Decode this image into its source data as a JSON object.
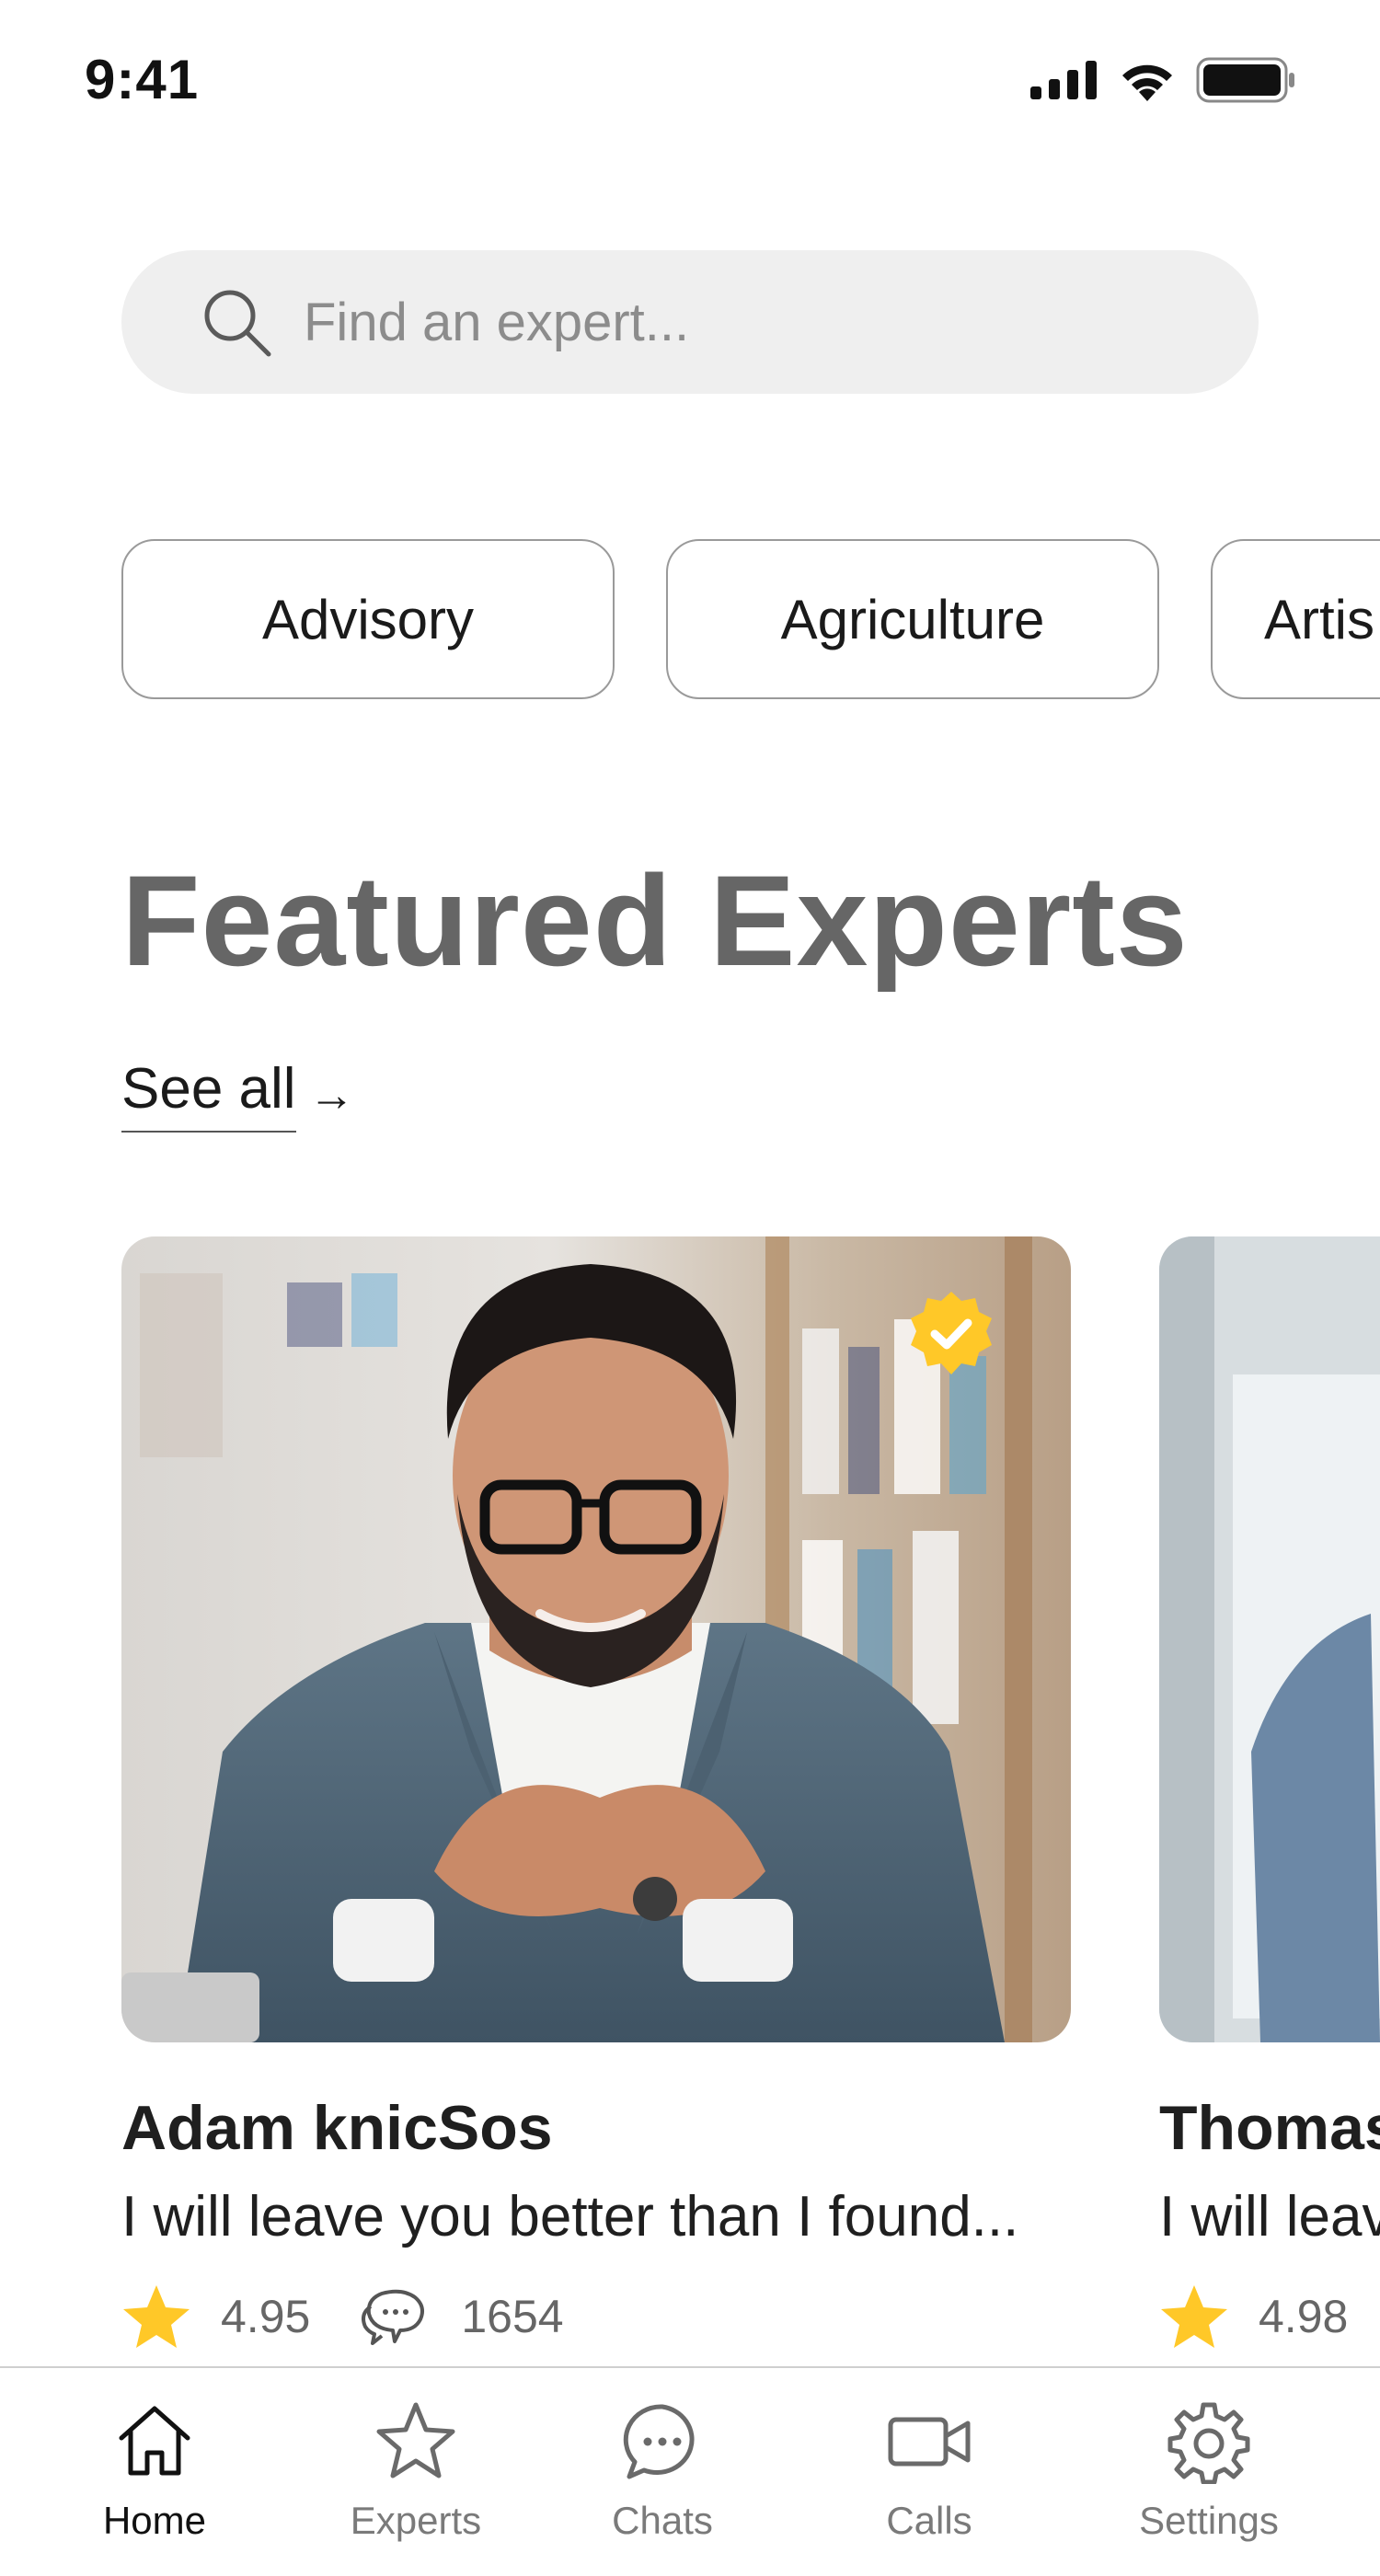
{
  "status_bar": {
    "time": "9:41"
  },
  "search": {
    "placeholder": "Find an expert..."
  },
  "categories": [
    "Advisory",
    "Agriculture",
    "Artis"
  ],
  "featured": {
    "title": "Featured Experts",
    "see_all_label": "See all",
    "see_all_arrow": "→"
  },
  "experts": [
    {
      "name": "Adam knicSos",
      "bio": "I will leave you better than I found...",
      "rating": "4.95",
      "reviews": "1654",
      "verified": true
    },
    {
      "name": "Thomas",
      "bio": "I will leav",
      "rating": "4.98"
    }
  ],
  "tab_bar": {
    "tabs": [
      {
        "label": "Home",
        "icon": "home-icon",
        "active": true
      },
      {
        "label": "Experts",
        "icon": "star-icon",
        "active": false
      },
      {
        "label": "Chats",
        "icon": "chat-bubble-icon",
        "active": false
      },
      {
        "label": "Calls",
        "icon": "video-camera-icon",
        "active": false
      },
      {
        "label": "Settings",
        "icon": "gear-icon",
        "active": false
      }
    ]
  },
  "colors": {
    "accent_yellow": "#FFC828",
    "heading_gray": "#666666",
    "search_bg": "#EFEFEF"
  }
}
